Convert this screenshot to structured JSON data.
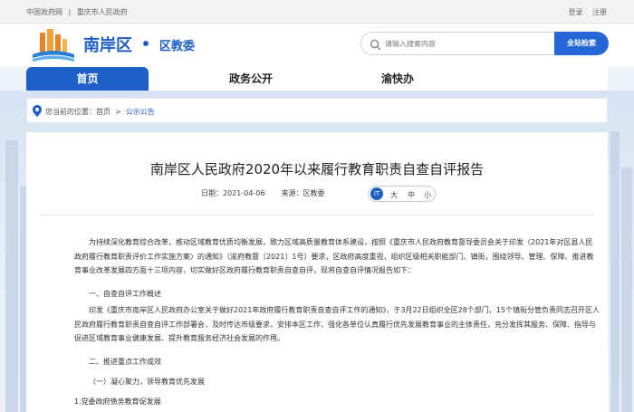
{
  "topbar": {
    "gov_link": "中国政府网",
    "sep": "|",
    "city_link": "重庆市人民政府",
    "login": "登录",
    "register": "注册"
  },
  "header": {
    "site_name": "南岸区",
    "sub_name": "区教委",
    "search_placeholder": "请输入搜索内容",
    "search_button": "全站检索"
  },
  "nav": {
    "items": [
      {
        "label": "首页"
      },
      {
        "label": "政务公开"
      },
      {
        "label": "渝快办"
      }
    ]
  },
  "breadcrumb": {
    "prefix": "您当前的位置：",
    "home": "首页",
    "sep": ">",
    "current": "公示公告"
  },
  "article": {
    "title": "南岸区人民政府2020年以来履行教育职责自查自评报告",
    "date": "日期：2021-04-06",
    "source": "来源：区教委",
    "font_icon": "iT",
    "font_large": "大",
    "font_medium": "中",
    "font_small": "小",
    "p1": "为持续深化教育综合改革，推动区域教育优质均衡发展，致力区域高质量教育体系建设，按照《重庆市人民政府教育督导委员会关于印发〈2021年对区县人民政府履行教育职责评价工作实施方案〉的通知》（渝府教督〔2021〕1号）要求，区政府高度重视，组织区级相关职能部门、镇街，围绕领导、管理、保障、推进教育事业改革发展四方面十三项内容，切实做好区政府履行教育职责自查自评，现将自查自评情况报告如下：",
    "h1": "一、自查自评工作概述",
    "p2": "印发《重庆市南岸区人民政府办公室关于做好2021年政府履行教育职责自查自评工作的通知》，于3月22日组织全区28个部门、15个镇街分管负责同志召开区人民政府履行教育职责自查自评工作部署会，及时传达市级要求，安排本区工作，强化各单位认真履行优先发展教育事业的主体责任，充分发挥其服务、保障、指导与促进区域教育事业健康发展、提升教育服务经济社会发展的作用。",
    "h2": "二、推进重点工作成效",
    "h3": "（一）凝心聚力，领导教育优先发展",
    "h4": "1.党委政府债务教育促发展"
  }
}
